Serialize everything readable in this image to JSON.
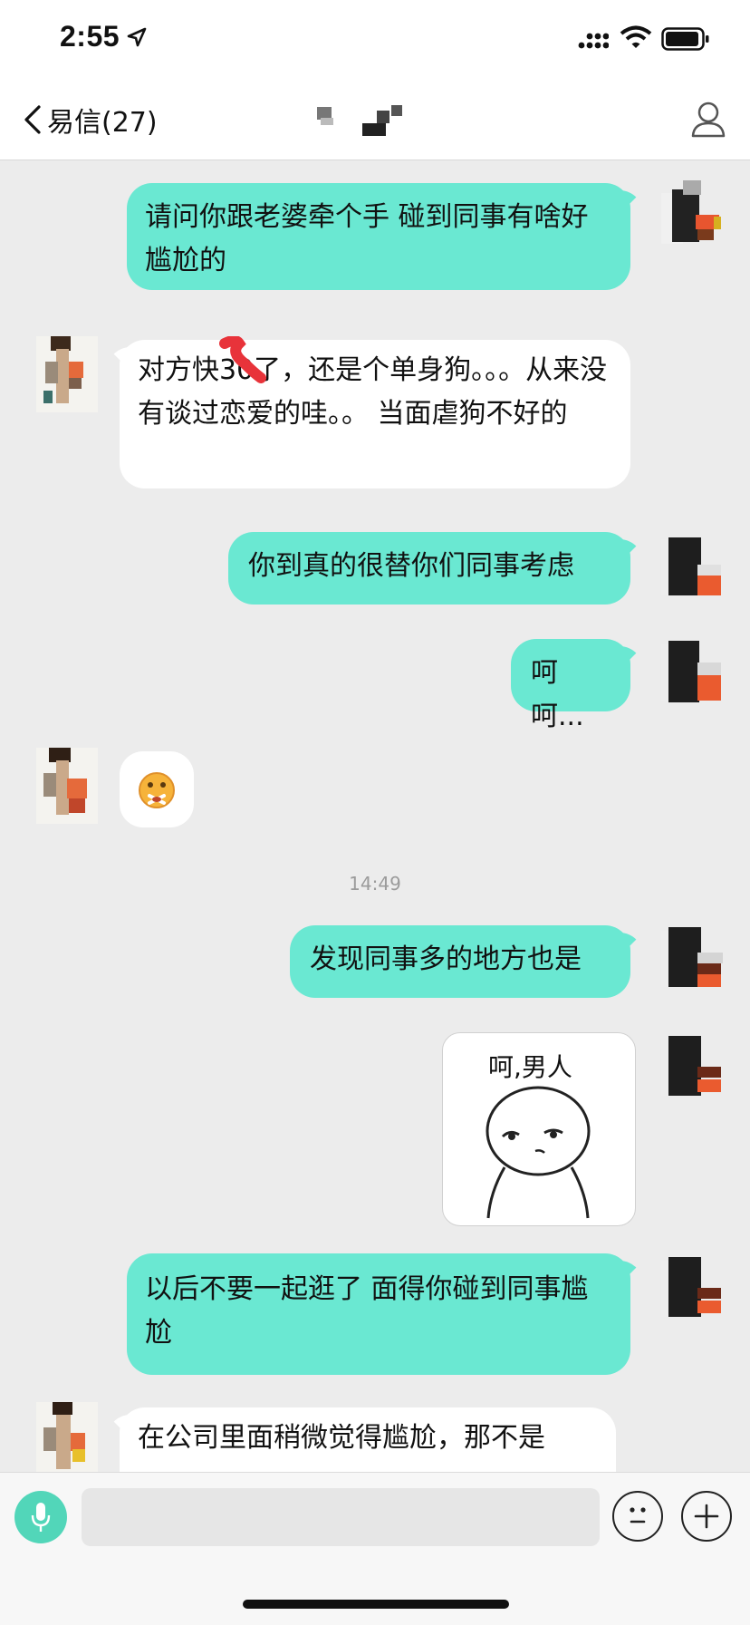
{
  "status_bar": {
    "time": "2:55"
  },
  "nav": {
    "back_label": "易信(27)"
  },
  "messages": [
    {
      "side": "out",
      "text": "请问你跟老婆牵个手 碰到同事有啥好尴尬的"
    },
    {
      "side": "in",
      "text": "对方快30了，还是个单身狗。。。从来没有谈过恋爱的哇。。 当面虐狗不好的"
    },
    {
      "side": "out",
      "text": "你到真的很替你们同事考虑"
    },
    {
      "side": "out",
      "text": "呵呵..."
    },
    {
      "side": "in",
      "type": "emoji",
      "icon": "surprised-face-emoji"
    },
    {
      "side": "out",
      "text": "发现同事多的地方也是"
    },
    {
      "side": "out",
      "type": "sticker",
      "caption": "呵,男人"
    },
    {
      "side": "out",
      "text": "以后不要一起逛了 面得你碰到同事尴尬"
    },
    {
      "side": "in",
      "text": "在公司里面稍微觉得尴尬，那不是"
    }
  ],
  "timestamp": "14:49",
  "input": {
    "placeholder": ""
  },
  "colors": {
    "outgoing_bubble": "#6ae8d2",
    "incoming_bubble": "#ffffff",
    "accent": "#52d6b9",
    "background": "#ececec"
  },
  "icons": [
    "location-arrow-icon",
    "signal-icon",
    "wifi-icon",
    "battery-icon",
    "back-chevron-icon",
    "profile-icon",
    "microphone-icon",
    "emoji-icon",
    "plus-icon"
  ]
}
